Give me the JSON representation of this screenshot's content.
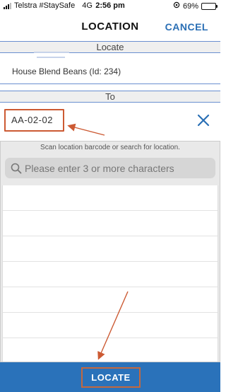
{
  "status_bar": {
    "carrier": "Telstra #StaySafe",
    "network": "4G",
    "time": "2:56 pm",
    "battery": "69%",
    "battery_level": 0.69
  },
  "header": {
    "title": "LOCATION",
    "cancel_label": "CANCEL"
  },
  "locate_section": {
    "label": "Locate",
    "item": "House Blend Beans (Id: 234)"
  },
  "to_section": {
    "label": "To",
    "location_value": "AA-02-02"
  },
  "scan": {
    "hint": "Scan location barcode or search for location.",
    "search_placeholder": "Please enter 3 or more characters"
  },
  "footer": {
    "locate_label": "LOCATE"
  },
  "colors": {
    "accent": "#2a72ba",
    "annotation": "#cc5a33"
  }
}
